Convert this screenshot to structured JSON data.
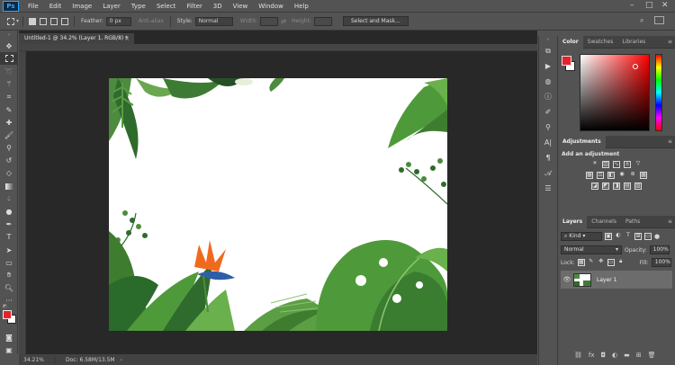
{
  "app": {
    "logo": "Ps"
  },
  "menubar": {
    "items": [
      "File",
      "Edit",
      "Image",
      "Layer",
      "Type",
      "Select",
      "Filter",
      "3D",
      "View",
      "Window",
      "Help"
    ]
  },
  "window_controls": {
    "minimize": "–",
    "maximize": "□",
    "close": "✕"
  },
  "options": {
    "feather_label": "Feather:",
    "feather_value": "0 px",
    "antialias_label": "Anti-alias",
    "style_label": "Style:",
    "style_value": "Normal",
    "width_label": "Width:",
    "height_label": "Height:",
    "select_mask_label": "Select and Mask..."
  },
  "document": {
    "tab_title": "Untitled-1 @ 34.2% (Layer 1, RGB/8) *",
    "close": "×",
    "zoom": "34.21%",
    "doc_size": "Doc: 6.58M/13.5M"
  },
  "panels": {
    "color_tabs": [
      "Color",
      "Swatches",
      "Libraries"
    ],
    "adjustments_tab": "Adjustments",
    "adjustments_heading": "Add an adjustment",
    "layers_tabs": [
      "Layers",
      "Channels",
      "Paths"
    ],
    "kind_label": "Kind",
    "blend_mode": "Normal",
    "opacity_label": "Opacity:",
    "opacity_value": "100%",
    "lock_label": "Lock:",
    "fill_label": "Fill:",
    "fill_value": "100%",
    "layer_name": "Layer 1",
    "panel_menu": "≡"
  },
  "colors": {
    "foreground": "#e8202a",
    "background": "#ffffff",
    "hue_field": "#ff0000",
    "accent_leaf": "#3f7d3a",
    "bird_of_paradise": "#f06a1e"
  }
}
